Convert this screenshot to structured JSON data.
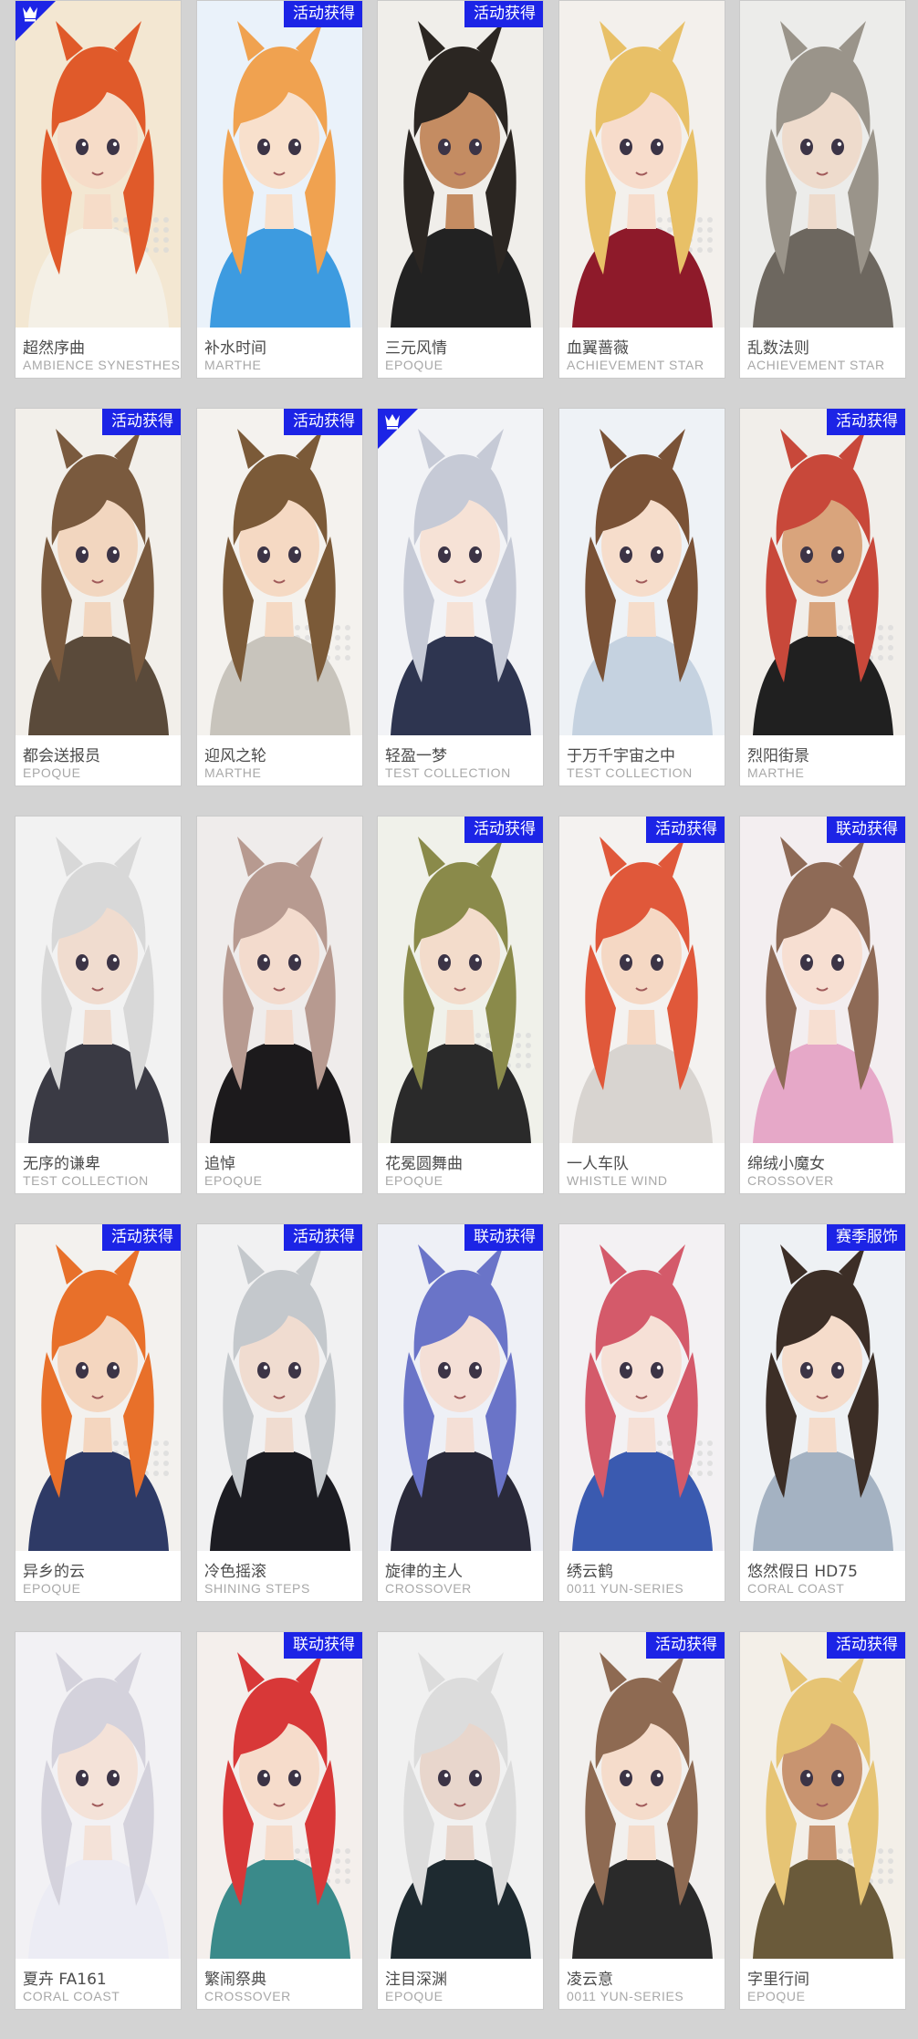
{
  "colors": {
    "background": "#d3d3d3",
    "badge": "#1c24e6",
    "card": "#ffffff",
    "name": "#4b4b4b",
    "series": "#a8a8a8"
  },
  "skins": [
    {
      "name": "超然序曲",
      "series": "AMBIENCE SYNESTHESIA",
      "badge": "",
      "corner_icon": "rarity-emblem-icon",
      "hair": "#e05a2a",
      "bg": "#f3e7d2",
      "outfit": "#f4f0e6",
      "skin": "#f6dcc8"
    },
    {
      "name": "补水时间",
      "series": "MARTHE",
      "badge": "活动获得",
      "corner_icon": "",
      "hair": "#f0a250",
      "bg": "#eaf2fa",
      "outfit": "#3d9be0",
      "skin": "#f8e0cc"
    },
    {
      "name": "三元风情",
      "series": "EPOQUE",
      "badge": "活动获得",
      "corner_icon": "",
      "hair": "#2b2622",
      "bg": "#f0eeea",
      "outfit": "#222222",
      "skin": "#c48c62"
    },
    {
      "name": "血翼蔷薇",
      "series": "ACHIEVEMENT STAR",
      "badge": "",
      "corner_icon": "",
      "hair": "#e8c067",
      "bg": "#f3f0ec",
      "outfit": "#8e1a2a",
      "skin": "#f7dccb"
    },
    {
      "name": "乱数法则",
      "series": "ACHIEVEMENT STAR",
      "badge": "",
      "corner_icon": "",
      "hair": "#9a948a",
      "bg": "#ececea",
      "outfit": "#6d675f",
      "skin": "#eedbcc"
    },
    {
      "name": "都会送报员",
      "series": "EPOQUE",
      "badge": "活动获得",
      "corner_icon": "",
      "hair": "#7a5a3e",
      "bg": "#f2efea",
      "outfit": "#5a4a3a",
      "skin": "#f2d6bf"
    },
    {
      "name": "迎风之轮",
      "series": "MARTHE",
      "badge": "活动获得",
      "corner_icon": "",
      "hair": "#7b5a38",
      "bg": "#f4f2ee",
      "outfit": "#c8c4bc",
      "skin": "#f5d9c3"
    },
    {
      "name": "轻盈一梦",
      "series": "TEST COLLECTION",
      "badge": "",
      "corner_icon": "rarity-emblem-icon",
      "hair": "#c6cad6",
      "bg": "#f2f3f6",
      "outfit": "#2e3550",
      "skin": "#f6e2d6"
    },
    {
      "name": "于万千宇宙之中",
      "series": "TEST COLLECTION",
      "badge": "",
      "corner_icon": "",
      "hair": "#7a5236",
      "bg": "#eef2f6",
      "outfit": "#c5d2e0",
      "skin": "#f6ddcb"
    },
    {
      "name": "烈阳街景",
      "series": "MARTHE",
      "badge": "活动获得",
      "corner_icon": "",
      "hair": "#c8483a",
      "bg": "#f1eeea",
      "outfit": "#202020",
      "skin": "#d9a47c"
    },
    {
      "name": "无序的谦卑",
      "series": "TEST COLLECTION",
      "badge": "",
      "corner_icon": "",
      "hair": "#d8d8d8",
      "bg": "#f2f2f2",
      "outfit": "#3a3a44",
      "skin": "#f0dccf"
    },
    {
      "name": "追悼",
      "series": "EPOQUE",
      "badge": "",
      "corner_icon": "",
      "hair": "#b79a90",
      "bg": "#efeceb",
      "outfit": "#1c1a1c",
      "skin": "#f3dbcd"
    },
    {
      "name": "花冕圆舞曲",
      "series": "EPOQUE",
      "badge": "活动获得",
      "corner_icon": "",
      "hair": "#8a8a4a",
      "bg": "#f0f1ea",
      "outfit": "#2a2a2a",
      "skin": "#f3dccb"
    },
    {
      "name": "一人车队",
      "series": "WHISTLE WIND",
      "badge": "活动获得",
      "corner_icon": "",
      "hair": "#e0583a",
      "bg": "#f4f2f0",
      "outfit": "#d8d4d0",
      "skin": "#f5d8c4"
    },
    {
      "name": "绵绒小魔女",
      "series": "CROSSOVER",
      "badge": "联动获得",
      "corner_icon": "",
      "hair": "#8e6a56",
      "bg": "#f3eef0",
      "outfit": "#e6a8c8",
      "skin": "#f7dfd2"
    },
    {
      "name": "异乡的云",
      "series": "EPOQUE",
      "badge": "活动获得",
      "corner_icon": "",
      "hair": "#e8702a",
      "bg": "#f3f1ee",
      "outfit": "#2e3a66",
      "skin": "#f4d6bf"
    },
    {
      "name": "冷色摇滚",
      "series": "SHINING STEPS",
      "badge": "活动获得",
      "corner_icon": "",
      "hair": "#c4c8cc",
      "bg": "#f1f1f2",
      "outfit": "#1c1c22",
      "skin": "#f0dcd0"
    },
    {
      "name": "旋律的主人",
      "series": "CROSSOVER",
      "badge": "联动获得",
      "corner_icon": "",
      "hair": "#6a74c8",
      "bg": "#eef0f6",
      "outfit": "#2a2a3a",
      "skin": "#f4dfd6"
    },
    {
      "name": "绣云鹤",
      "series": "0011 YUN-SERIES",
      "badge": "",
      "corner_icon": "",
      "hair": "#d45a6a",
      "bg": "#f3f1f3",
      "outfit": "#3a5ab0",
      "skin": "#f6e0d6"
    },
    {
      "name": "悠然假日 HD75",
      "series": "CORAL COAST",
      "badge": "赛季服饰",
      "corner_icon": "",
      "hair": "#3c2e26",
      "bg": "#eef1f4",
      "outfit": "#a4b2c2",
      "skin": "#f5dccb"
    },
    {
      "name": "夏卉 FA161",
      "series": "CORAL COAST",
      "badge": "",
      "corner_icon": "",
      "hair": "#d4d2dc",
      "bg": "#f2f1f4",
      "outfit": "#ececf4",
      "skin": "#f4e2d8"
    },
    {
      "name": "繁闹祭典",
      "series": "CROSSOVER",
      "badge": "联动获得",
      "corner_icon": "",
      "hair": "#d83838",
      "bg": "#f4efec",
      "outfit": "#3a8a8a",
      "skin": "#f6dccb"
    },
    {
      "name": "注目深渊",
      "series": "EPOQUE",
      "badge": "",
      "corner_icon": "",
      "hair": "#dcdcdc",
      "bg": "#f1f1f1",
      "outfit": "#1e2a30",
      "skin": "#e8d6cc"
    },
    {
      "name": "凌云意",
      "series": "0011 YUN-SERIES",
      "badge": "活动获得",
      "corner_icon": "",
      "hair": "#8e6a52",
      "bg": "#f2f0ee",
      "outfit": "#2a2a2a",
      "skin": "#f5dccb"
    },
    {
      "name": "字里行间",
      "series": "EPOQUE",
      "badge": "活动获得",
      "corner_icon": "",
      "hair": "#e6c474",
      "bg": "#f3efe8",
      "outfit": "#6a5a3a",
      "skin": "#c89470"
    }
  ]
}
